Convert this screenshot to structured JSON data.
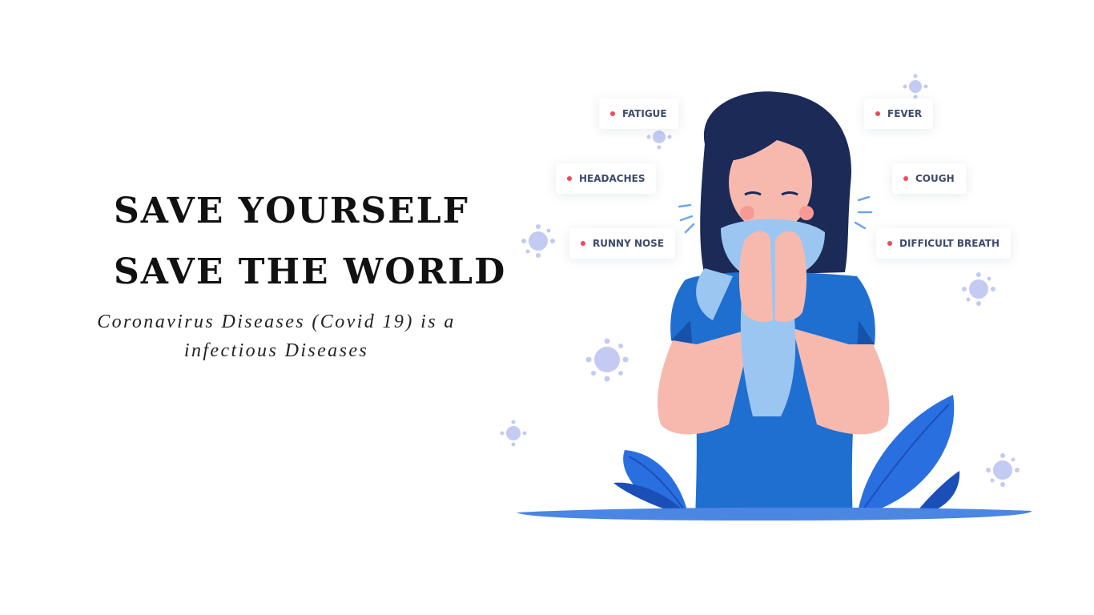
{
  "headline": {
    "line1": "SAVE YOURSELF",
    "line2": "SAVE THE WORLD"
  },
  "subtitle": "Coronavirus Diseases (Covid 19) is a infectious Diseases",
  "symptoms": {
    "fatigue": "FATIGUE",
    "headaches": "HEADACHES",
    "runny_nose": "RUNNY NOSE",
    "fever": "FEVER",
    "cough": "COUGH",
    "difficult_breath": "DIFFICULT BREATH"
  },
  "colors": {
    "title": "#111111",
    "tag_text": "#3e4a6b",
    "tag_dot": "#ef4a5c",
    "shirt": "#1f6fd1",
    "hair": "#1b2a57",
    "skin": "#f7b9ae",
    "scarf": "#9cc6f2",
    "virus": "#b9c3f0",
    "leaf": "#2a6fe0"
  },
  "icons": [
    "virus-icon",
    "person-illustration",
    "leaf-illustration"
  ]
}
